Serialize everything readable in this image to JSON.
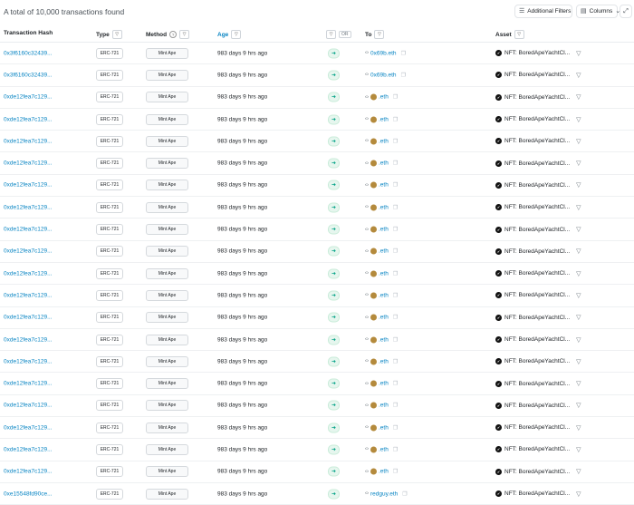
{
  "summary": "A total of 10,000 transactions found",
  "toolbar": {
    "filters_label": "Additional Filters",
    "columns_label": "Columns"
  },
  "headers": {
    "hash": "Transaction Hash",
    "type": "Type",
    "method": "Method",
    "age": "Age",
    "fiat_toggle": "OR",
    "to": "To",
    "asset": "Asset"
  },
  "rows": [
    {
      "hash": "0x3f6160c32439...",
      "type": "ERC-721",
      "method": "Mint Ape",
      "age": "983 days 9 hrs ago",
      "to": "0x69b.eth",
      "to_kind": "plain",
      "asset": "NFT: BoredApeYachtCl..."
    },
    {
      "hash": "0x3f6160c32439...",
      "type": "ERC-721",
      "method": "Mint Ape",
      "age": "983 days 9 hrs ago",
      "to": "0x69b.eth",
      "to_kind": "plain",
      "asset": "NFT: BoredApeYachtCl..."
    },
    {
      "hash": "0xde12fea7c129...",
      "type": "ERC-721",
      "method": "Mint Ape",
      "age": "983 days 9 hrs ago",
      "to": ".eth",
      "to_kind": "ape",
      "asset": "NFT: BoredApeYachtCl..."
    },
    {
      "hash": "0xde12fea7c129...",
      "type": "ERC-721",
      "method": "Mint Ape",
      "age": "983 days 9 hrs ago",
      "to": ".eth",
      "to_kind": "ape",
      "asset": "NFT: BoredApeYachtCl..."
    },
    {
      "hash": "0xde12fea7c129...",
      "type": "ERC-721",
      "method": "Mint Ape",
      "age": "983 days 9 hrs ago",
      "to": ".eth",
      "to_kind": "ape",
      "asset": "NFT: BoredApeYachtCl..."
    },
    {
      "hash": "0xde12fea7c129...",
      "type": "ERC-721",
      "method": "Mint Ape",
      "age": "983 days 9 hrs ago",
      "to": ".eth",
      "to_kind": "ape",
      "asset": "NFT: BoredApeYachtCl..."
    },
    {
      "hash": "0xde12fea7c129...",
      "type": "ERC-721",
      "method": "Mint Ape",
      "age": "983 days 9 hrs ago",
      "to": ".eth",
      "to_kind": "ape",
      "asset": "NFT: BoredApeYachtCl..."
    },
    {
      "hash": "0xde12fea7c129...",
      "type": "ERC-721",
      "method": "Mint Ape",
      "age": "983 days 9 hrs ago",
      "to": ".eth",
      "to_kind": "ape",
      "asset": "NFT: BoredApeYachtCl..."
    },
    {
      "hash": "0xde12fea7c129...",
      "type": "ERC-721",
      "method": "Mint Ape",
      "age": "983 days 9 hrs ago",
      "to": ".eth",
      "to_kind": "ape",
      "asset": "NFT: BoredApeYachtCl..."
    },
    {
      "hash": "0xde12fea7c129...",
      "type": "ERC-721",
      "method": "Mint Ape",
      "age": "983 days 9 hrs ago",
      "to": ".eth",
      "to_kind": "ape",
      "asset": "NFT: BoredApeYachtCl..."
    },
    {
      "hash": "0xde12fea7c129...",
      "type": "ERC-721",
      "method": "Mint Ape",
      "age": "983 days 9 hrs ago",
      "to": ".eth",
      "to_kind": "ape",
      "asset": "NFT: BoredApeYachtCl..."
    },
    {
      "hash": "0xde12fea7c129...",
      "type": "ERC-721",
      "method": "Mint Ape",
      "age": "983 days 9 hrs ago",
      "to": ".eth",
      "to_kind": "ape",
      "asset": "NFT: BoredApeYachtCl..."
    },
    {
      "hash": "0xde12fea7c129...",
      "type": "ERC-721",
      "method": "Mint Ape",
      "age": "983 days 9 hrs ago",
      "to": ".eth",
      "to_kind": "ape",
      "asset": "NFT: BoredApeYachtCl..."
    },
    {
      "hash": "0xde12fea7c129...",
      "type": "ERC-721",
      "method": "Mint Ape",
      "age": "983 days 9 hrs ago",
      "to": ".eth",
      "to_kind": "ape",
      "asset": "NFT: BoredApeYachtCl..."
    },
    {
      "hash": "0xde12fea7c129...",
      "type": "ERC-721",
      "method": "Mint Ape",
      "age": "983 days 9 hrs ago",
      "to": ".eth",
      "to_kind": "ape",
      "asset": "NFT: BoredApeYachtCl..."
    },
    {
      "hash": "0xde12fea7c129...",
      "type": "ERC-721",
      "method": "Mint Ape",
      "age": "983 days 9 hrs ago",
      "to": ".eth",
      "to_kind": "ape",
      "asset": "NFT: BoredApeYachtCl..."
    },
    {
      "hash": "0xde12fea7c129...",
      "type": "ERC-721",
      "method": "Mint Ape",
      "age": "983 days 9 hrs ago",
      "to": ".eth",
      "to_kind": "ape",
      "asset": "NFT: BoredApeYachtCl..."
    },
    {
      "hash": "0xde12fea7c129...",
      "type": "ERC-721",
      "method": "Mint Ape",
      "age": "983 days 9 hrs ago",
      "to": ".eth",
      "to_kind": "ape",
      "asset": "NFT: BoredApeYachtCl..."
    },
    {
      "hash": "0xde12fea7c129...",
      "type": "ERC-721",
      "method": "Mint Ape",
      "age": "983 days 9 hrs ago",
      "to": ".eth",
      "to_kind": "ape",
      "asset": "NFT: BoredApeYachtCl..."
    },
    {
      "hash": "0xde12fea7c129...",
      "type": "ERC-721",
      "method": "Mint Ape",
      "age": "983 days 9 hrs ago",
      "to": ".eth",
      "to_kind": "ape",
      "asset": "NFT: BoredApeYachtCl..."
    },
    {
      "hash": "0xe15548fd90ce...",
      "type": "ERC-721",
      "method": "Mint Ape",
      "age": "983 days 9 hrs ago",
      "to": "redguy.eth",
      "to_kind": "plain",
      "asset": "NFT: BoredApeYachtCl..."
    }
  ],
  "icons": {
    "filter": "filter-icon",
    "direction": "arrow-right-icon",
    "contract": "contract-icon",
    "copy": "copy-icon",
    "nft": "nft-token-icon"
  },
  "colors": {
    "link": "#0784c3",
    "in_badge": "#00a186"
  }
}
